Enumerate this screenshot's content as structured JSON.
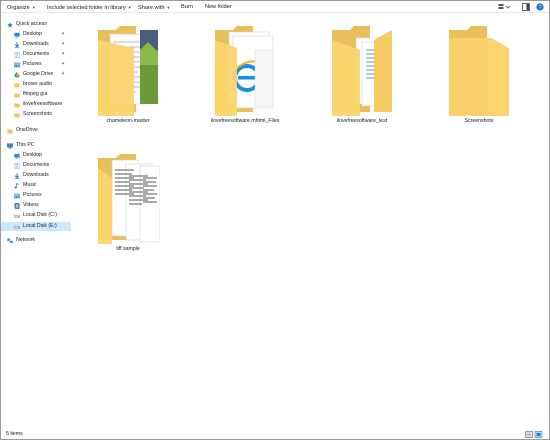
{
  "toolbar": {
    "organize": "Organize",
    "include_in_library": "Include selected folder in library",
    "share_with": "Share with",
    "burn": "Burn",
    "new_folder": "New folder"
  },
  "nav": {
    "quick_access": "Quick access",
    "desktop": "Desktop",
    "downloads": "Downloads",
    "documents": "Documents",
    "pictures": "Pictures",
    "google_drive": "Google Drive",
    "broser_audio": "broser audio",
    "ffmpeg_gui": "ffmpeg gui",
    "ilovefreesoftware": "ilovefreesoftware",
    "screenshots": "Screenshots",
    "onedrive": "OneDrive",
    "this_pc": "This PC",
    "pc_desktop": "Desktop",
    "pc_documents": "Documents",
    "pc_downloads": "Downloads",
    "pc_music": "Music",
    "pc_pictures": "Pictures",
    "pc_videos": "Videos",
    "local_disk_c": "Local Disk (C:)",
    "local_disk_e": "Local Disk (E:)",
    "network": "Network"
  },
  "folders": {
    "f1": "chameleon-master",
    "f2": "ilovefreesoftware.mhtml_Files",
    "f3": "ilovefreesoftware_test",
    "f4": "Screenshots",
    "f5": "tiff sample"
  },
  "status": {
    "count": "5 items"
  },
  "colors": {
    "folder_back": "#e8bf5a",
    "folder_front": "#fad46e",
    "selection": "#cce8ff",
    "accent": "#1e7bd6"
  }
}
